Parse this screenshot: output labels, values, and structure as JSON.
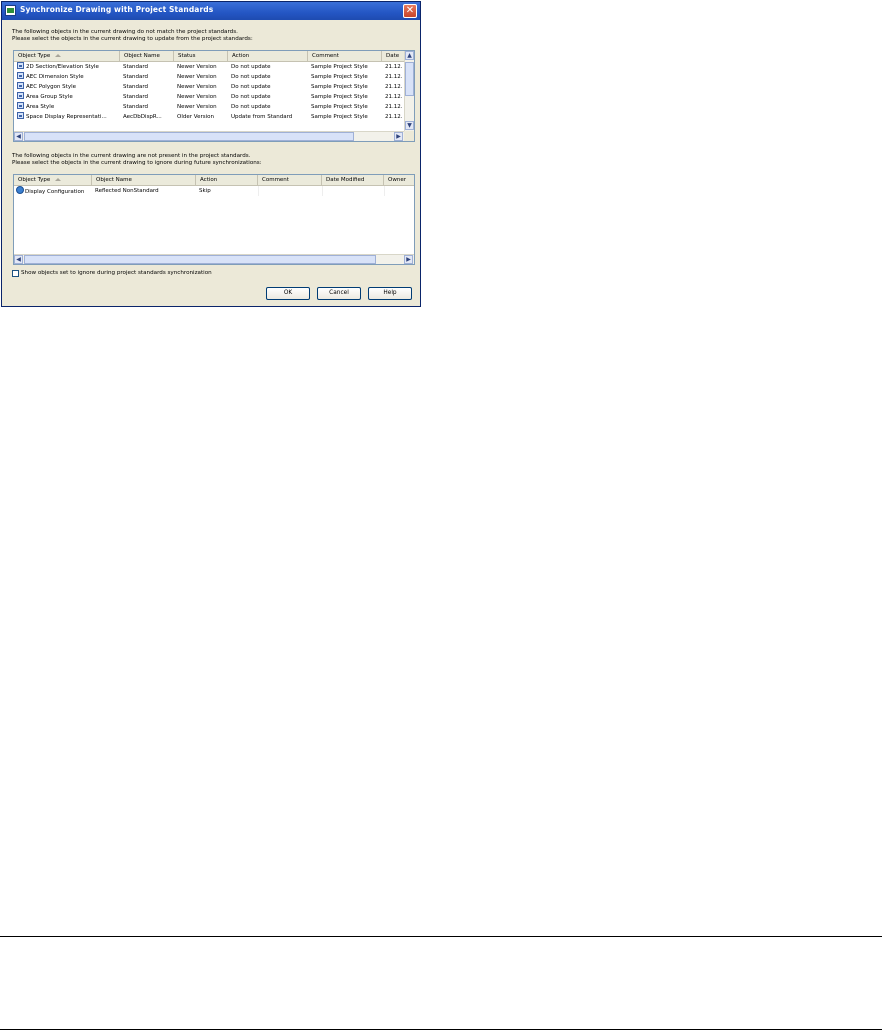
{
  "window": {
    "title": "Synchronize Drawing with Project Standards",
    "close_label": "✕"
  },
  "section1": {
    "instruction_line1": "The following objects in the current drawing do not match the project standards.",
    "instruction_line2": "Please select the objects in the current drawing to update from the project standards:",
    "columns": [
      "Object Type",
      "Object Name",
      "Status",
      "Action",
      "Comment",
      "Date"
    ],
    "rows": [
      [
        "2D Section/Elevation Style",
        "Standard",
        "Newer Version",
        "Do not update",
        "Sample Project Style",
        "21.12."
      ],
      [
        "AEC Dimension Style",
        "Standard",
        "Newer Version",
        "Do not update",
        "Sample Project Style",
        "21.12."
      ],
      [
        "AEC Polygon Style",
        "Standard",
        "Newer Version",
        "Do not update",
        "Sample Project Style",
        "21.12."
      ],
      [
        "Area Group Style",
        "Standard",
        "Newer Version",
        "Do not update",
        "Sample Project Style",
        "21.12."
      ],
      [
        "Area Style",
        "Standard",
        "Newer Version",
        "Do not update",
        "Sample Project Style",
        "21.12."
      ],
      [
        "Space Display Representati...",
        "AecDbDispR...",
        "Older Version",
        "Update from Standard",
        "Sample Project Style",
        "21.12."
      ]
    ]
  },
  "section2": {
    "instruction_line1": "The following objects in the current drawing are not present in the project standards.",
    "instruction_line2": "Please select the objects in the current drawing to ignore during future synchronizations:",
    "columns": [
      "Object Type",
      "Object Name",
      "Action",
      "Comment",
      "Date Modified",
      "Owner"
    ],
    "rows": [
      [
        "Display Configuration",
        "Reflected NonStandard",
        "Skip",
        "",
        "",
        ""
      ]
    ]
  },
  "options": {
    "show_ignored_label": "Show objects set to ignore during project standards synchronization",
    "show_ignored_checked": false
  },
  "buttons": {
    "ok": "OK",
    "cancel": "Cancel",
    "help": "Help"
  }
}
